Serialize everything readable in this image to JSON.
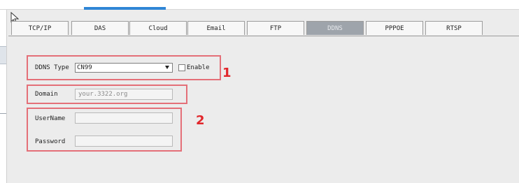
{
  "tabs": [
    {
      "label": "TCP/IP",
      "active": false
    },
    {
      "label": "DAS",
      "active": false
    },
    {
      "label": "Cloud",
      "active": false
    },
    {
      "label": "Email",
      "active": false
    },
    {
      "label": "FTP",
      "active": false
    },
    {
      "label": "DDNS",
      "active": true
    },
    {
      "label": "PPPOE",
      "active": false
    },
    {
      "label": "RTSP",
      "active": false
    }
  ],
  "ddns": {
    "type_label": "DDNS Type",
    "type_value": "CN99",
    "enable_label": "Enable",
    "enable_checked": false,
    "domain_label": "Domain",
    "domain_placeholder": "your.3322.org",
    "username_label": "UserName",
    "username_value": "",
    "password_label": "Password",
    "password_value": ""
  },
  "annotations": {
    "marker1": "1",
    "marker2": "2"
  },
  "colors": {
    "accent": "#2f86d6",
    "highlight_box": "#e46f78",
    "marker": "#e1262b",
    "active_tab": "#9ea4ab"
  },
  "icons": {
    "cursor": "cursor-icon",
    "dropdown": "chevron-down-icon"
  }
}
